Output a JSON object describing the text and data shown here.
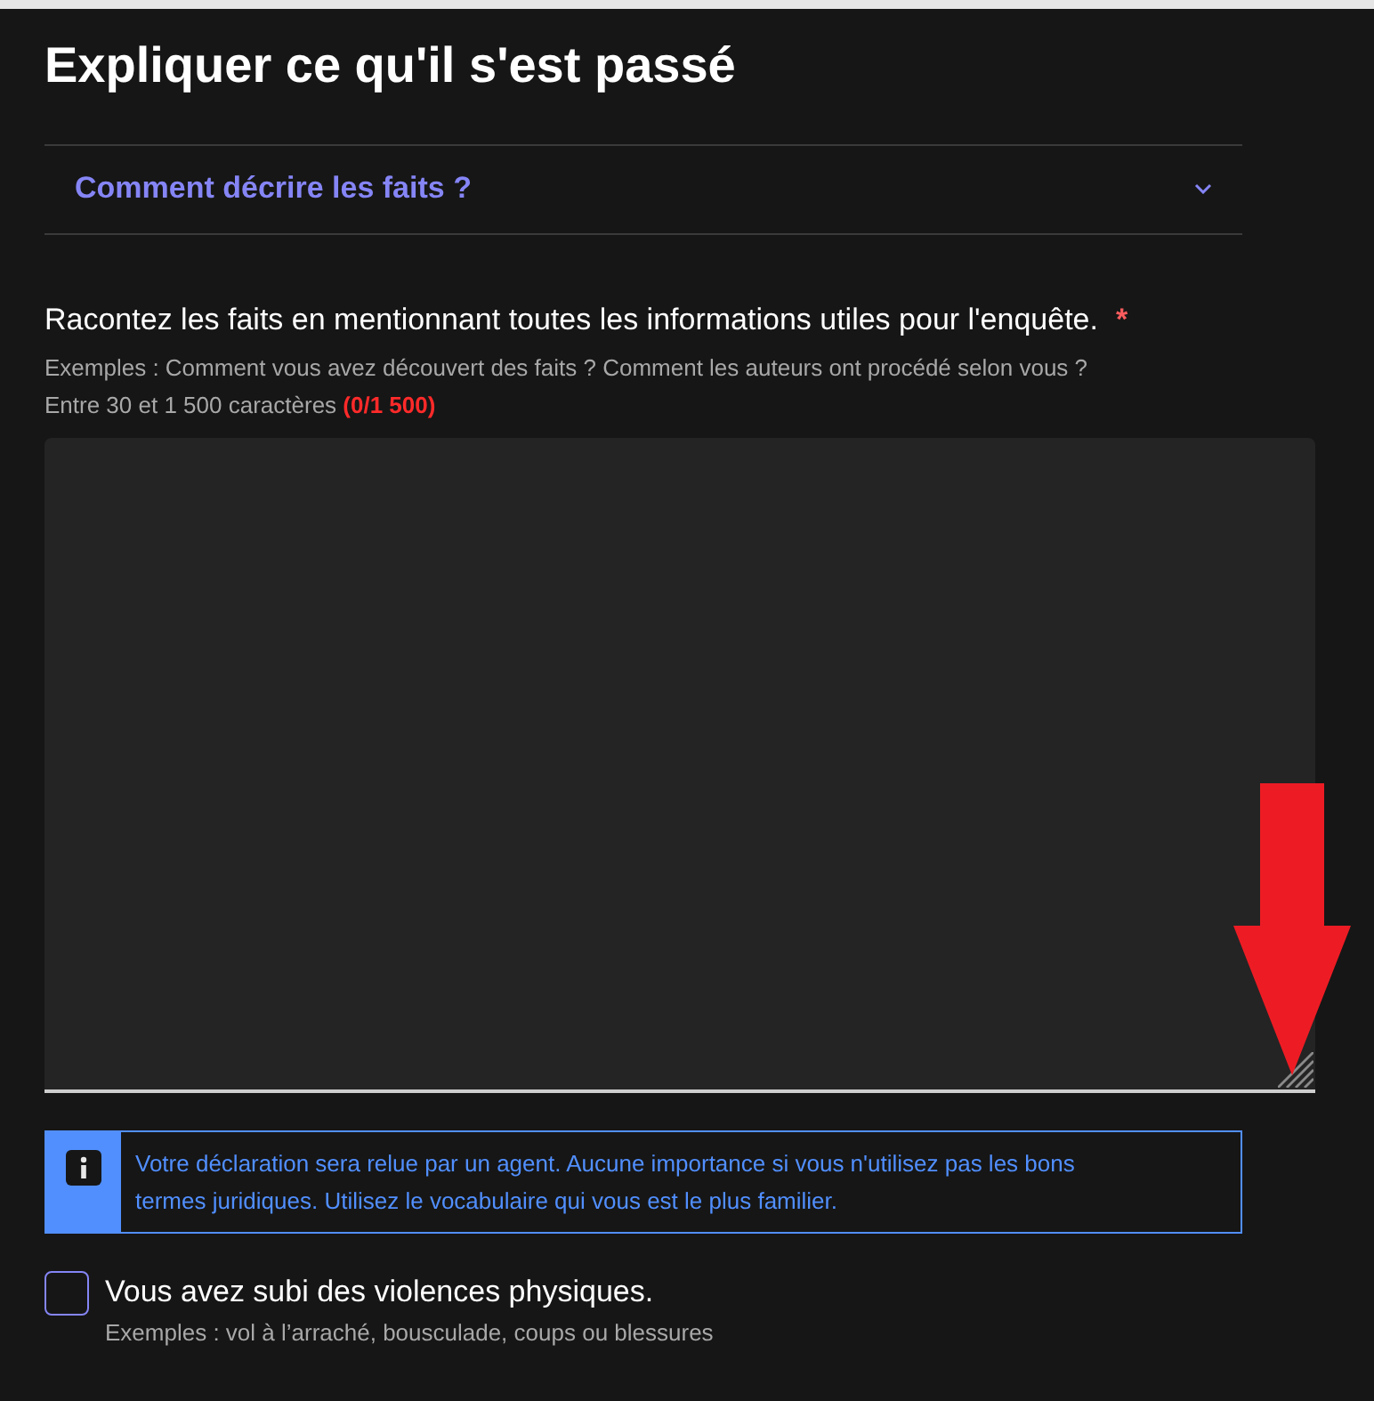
{
  "heading": "Expliquer ce qu'il s'est passé",
  "accordion": {
    "label": "Comment décrire les faits ?",
    "expanded": false
  },
  "field": {
    "label": "Racontez les faits en mentionnant toutes les informations utiles pour l'enquête.",
    "required_mark": "*",
    "hint": "Exemples : Comment vous avez découvert des faits ? Comment les auteurs ont procédé selon vous ?",
    "limit": "Entre 30 et 1 500 caractères",
    "counter": "(0/1 500)"
  },
  "notice": {
    "text": "Votre déclaration sera relue par un agent. Aucune importance si vous n'utilisez pas les bons termes juridiques. Utilisez le vocabulaire qui vous est le plus familier."
  },
  "checkbox": {
    "label": "Vous avez subi des violences physiques.",
    "checked": false,
    "hint": "Exemples : vol à l’arraché, bousculade, coups ou blessures"
  }
}
